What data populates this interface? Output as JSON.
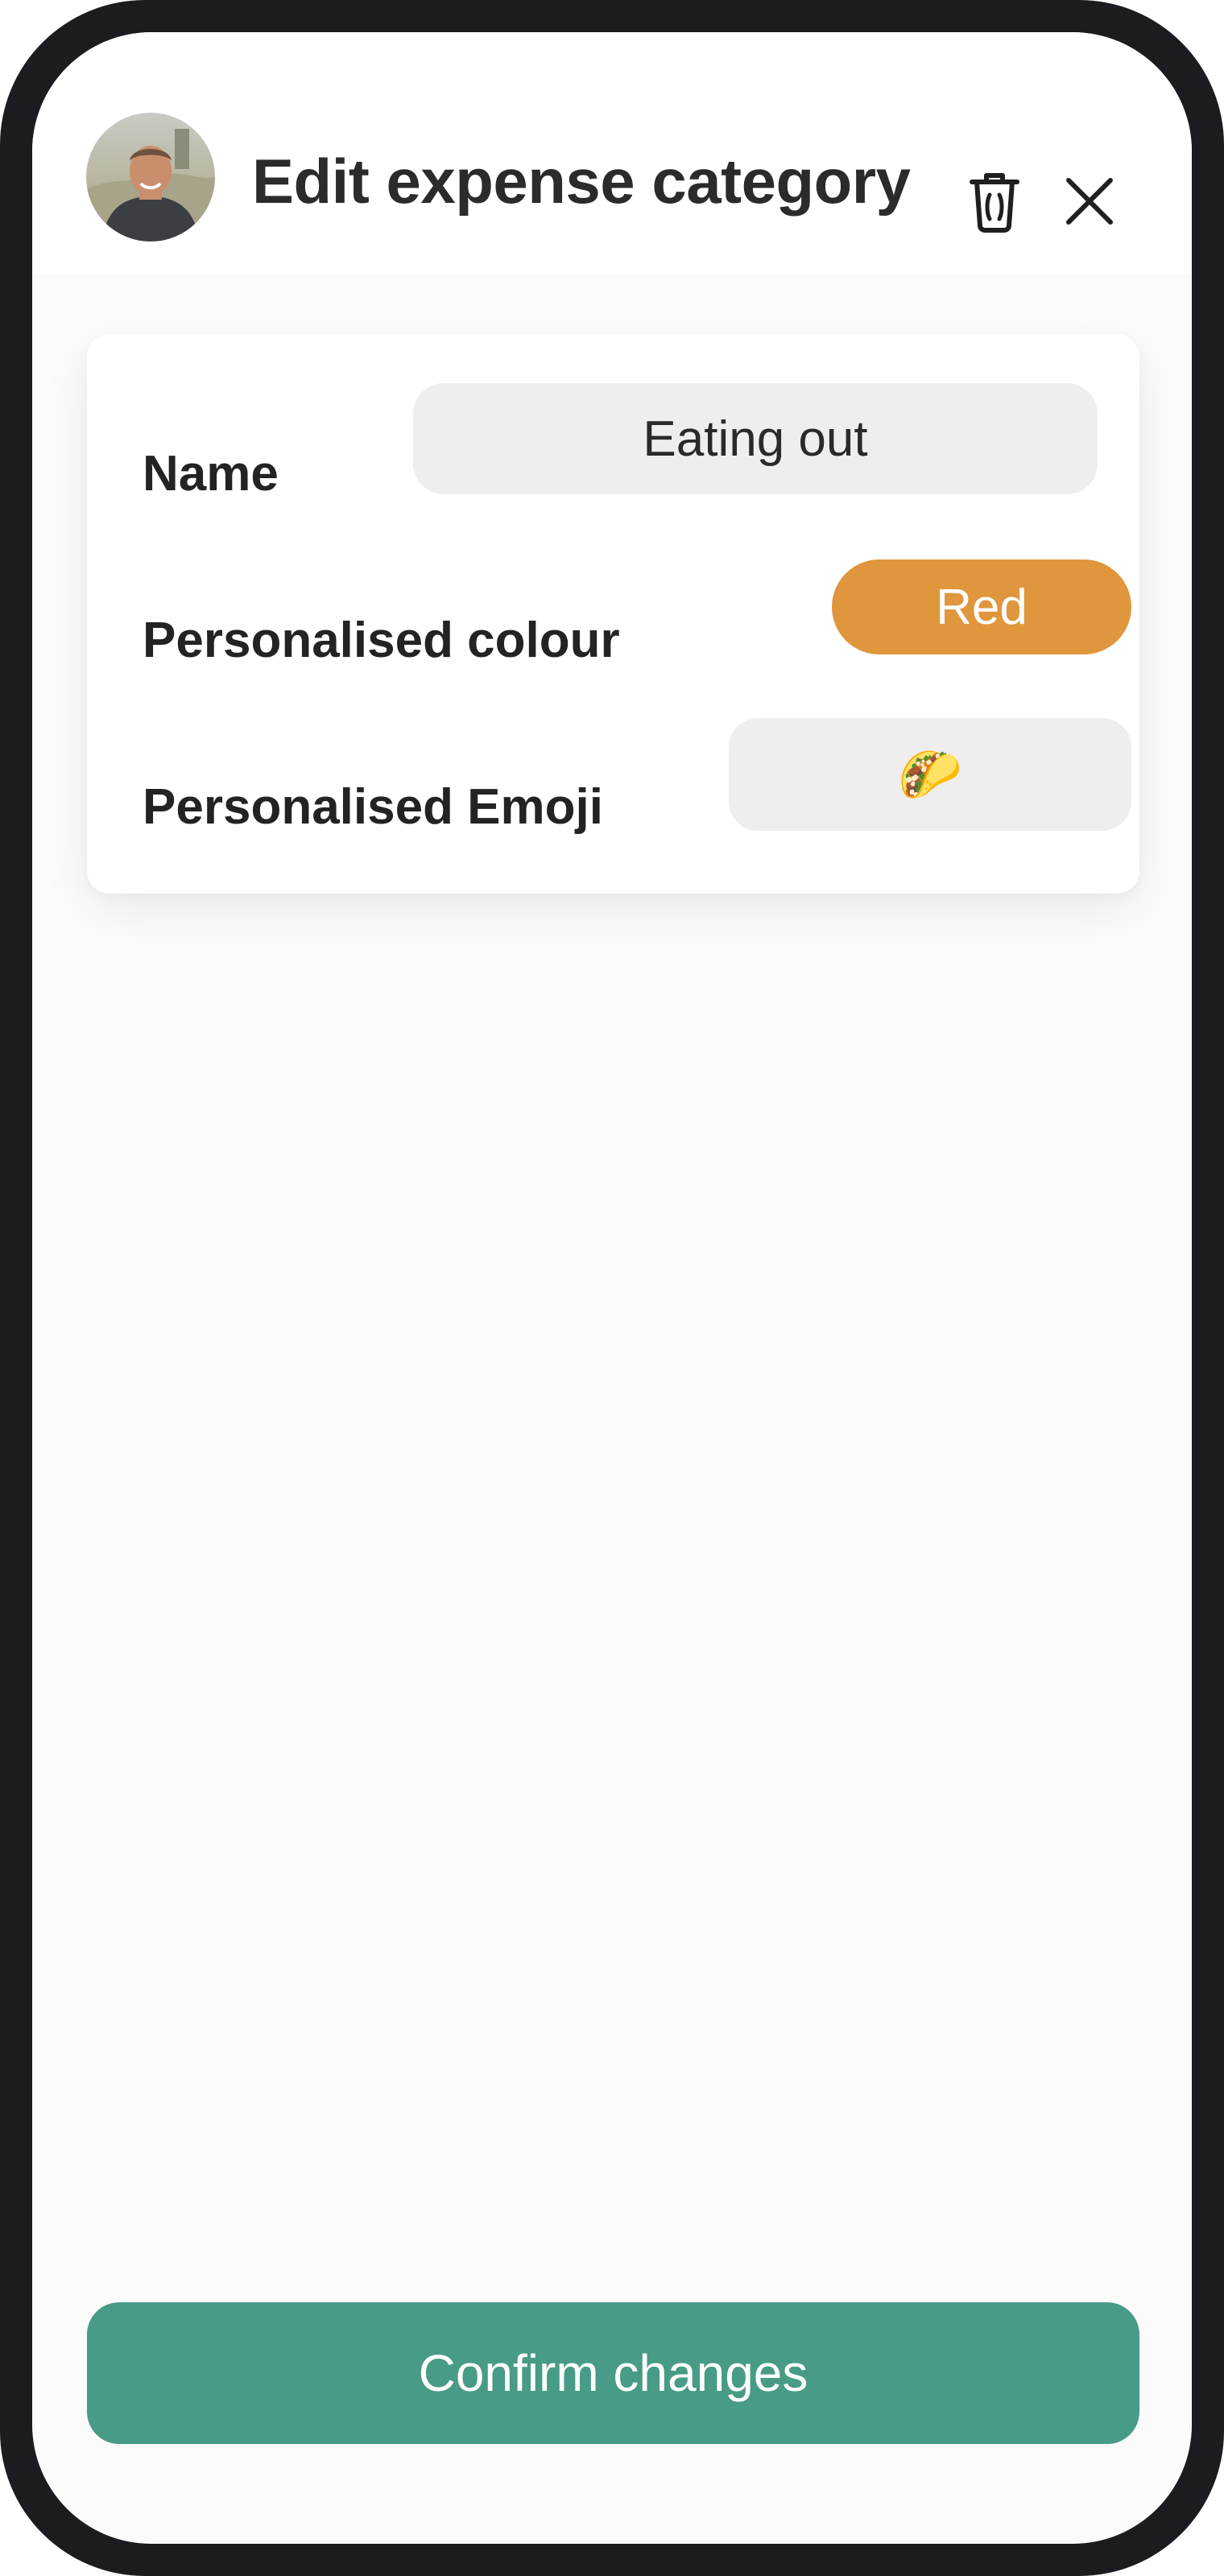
{
  "header": {
    "title": "Edit expense category",
    "avatar_alt": "user-avatar",
    "delete_icon": "trash-icon",
    "close_icon": "close-icon"
  },
  "form": {
    "name": {
      "label": "Name",
      "value": "Eating out"
    },
    "colour": {
      "label": "Personalised colour",
      "value": "Red",
      "swatch_color": "#e0963d"
    },
    "emoji": {
      "label": "Personalised Emoji",
      "value": "🌮"
    }
  },
  "footer": {
    "confirm_label": "Confirm changes",
    "confirm_color": "#479b87"
  }
}
